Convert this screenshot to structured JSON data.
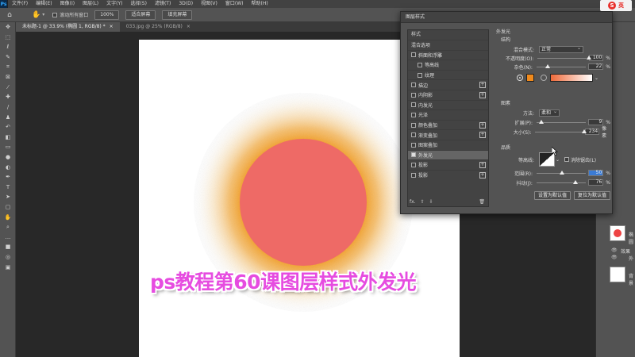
{
  "menubar": {
    "logo": "Ps",
    "items": [
      "文件(F)",
      "编辑(E)",
      "图像(I)",
      "图层(L)",
      "文字(Y)",
      "选择(S)",
      "滤镜(T)",
      "3D(D)",
      "视图(V)",
      "窗口(W)",
      "帮助(H)"
    ],
    "win_controls": [
      "—",
      "❐",
      "✕"
    ]
  },
  "ime": {
    "icon_letter": "S",
    "text": "英"
  },
  "options": {
    "scroll_all_label": "滚动所有窗口",
    "zoom_value": "100%",
    "fit_screen_label": "适合屏幕",
    "fill_screen_label": "填充屏幕"
  },
  "tabs": [
    {
      "title": "未标题-1 @ 33.9% (椭圆 1, RGB/8) *",
      "close": "×",
      "active": true
    },
    {
      "title": "033.jpg @ 25% (RGB/8)",
      "close": "×",
      "active": false
    }
  ],
  "dialog": {
    "title": "图层样式",
    "list_header": "样式",
    "blend_options": "混合选项",
    "styles": [
      {
        "label": "斜面和浮雕",
        "checked": false,
        "plus": false,
        "indent": false
      },
      {
        "label": "等高线",
        "checked": false,
        "plus": false,
        "indent": true
      },
      {
        "label": "纹理",
        "checked": false,
        "plus": false,
        "indent": true
      },
      {
        "label": "描边",
        "checked": false,
        "plus": true,
        "indent": false
      },
      {
        "label": "内阴影",
        "checked": false,
        "plus": true,
        "indent": false
      },
      {
        "label": "内发光",
        "checked": false,
        "plus": false,
        "indent": false
      },
      {
        "label": "光泽",
        "checked": false,
        "plus": false,
        "indent": false
      },
      {
        "label": "颜色叠加",
        "checked": false,
        "plus": true,
        "indent": false
      },
      {
        "label": "渐变叠加",
        "checked": false,
        "plus": true,
        "indent": false
      },
      {
        "label": "图案叠加",
        "checked": false,
        "plus": false,
        "indent": false
      },
      {
        "label": "外发光",
        "checked": true,
        "plus": false,
        "indent": false,
        "selected": true
      },
      {
        "label": "投影",
        "checked": false,
        "plus": true,
        "indent": false
      },
      {
        "label": "投影",
        "checked": false,
        "plus": true,
        "indent": false
      }
    ],
    "footer_fx": "fx.",
    "panel_title": "外发光",
    "structure": {
      "title": "结构",
      "blend_mode_label": "混合模式:",
      "blend_mode": "正常",
      "opacity_label": "不透明度(O):",
      "opacity": "100",
      "opacity_level": 1.0,
      "noise_label": "杂色(N):",
      "noise": "22",
      "noise_level": 0.22,
      "unit": "%",
      "color": "#f08a1c",
      "gradient_from": "#ef6a3a",
      "gradient_to": "#ffffff"
    },
    "elements": {
      "title": "图素",
      "method_label": "方法:",
      "method": "柔和",
      "spread_label": "扩展(P):",
      "spread": "9",
      "spread_level": 0.09,
      "size_label": "大小(S):",
      "size": "234",
      "size_level": 0.94,
      "size_unit": "像素"
    },
    "quality": {
      "title": "品质",
      "contour_label": "等高线:",
      "antialias_label": "消除锯齿(L)",
      "range_label": "范围(R):",
      "range": "50",
      "range_level": 0.5,
      "jitter_label": "抖动(J):",
      "jitter": "76",
      "jitter_level": 0.76
    },
    "make_default": "设置为默认值",
    "reset_default": "复位为默认值"
  },
  "layers": {
    "ellipse_name": "椭圆",
    "effects_label": "效果",
    "outer_glow_short": "外",
    "bg_name": "背景"
  },
  "caption": "ps教程第60课图层样式外发光",
  "artwork": {
    "circle_color": "#ee6a66",
    "glow_color": "#f29a1c"
  }
}
